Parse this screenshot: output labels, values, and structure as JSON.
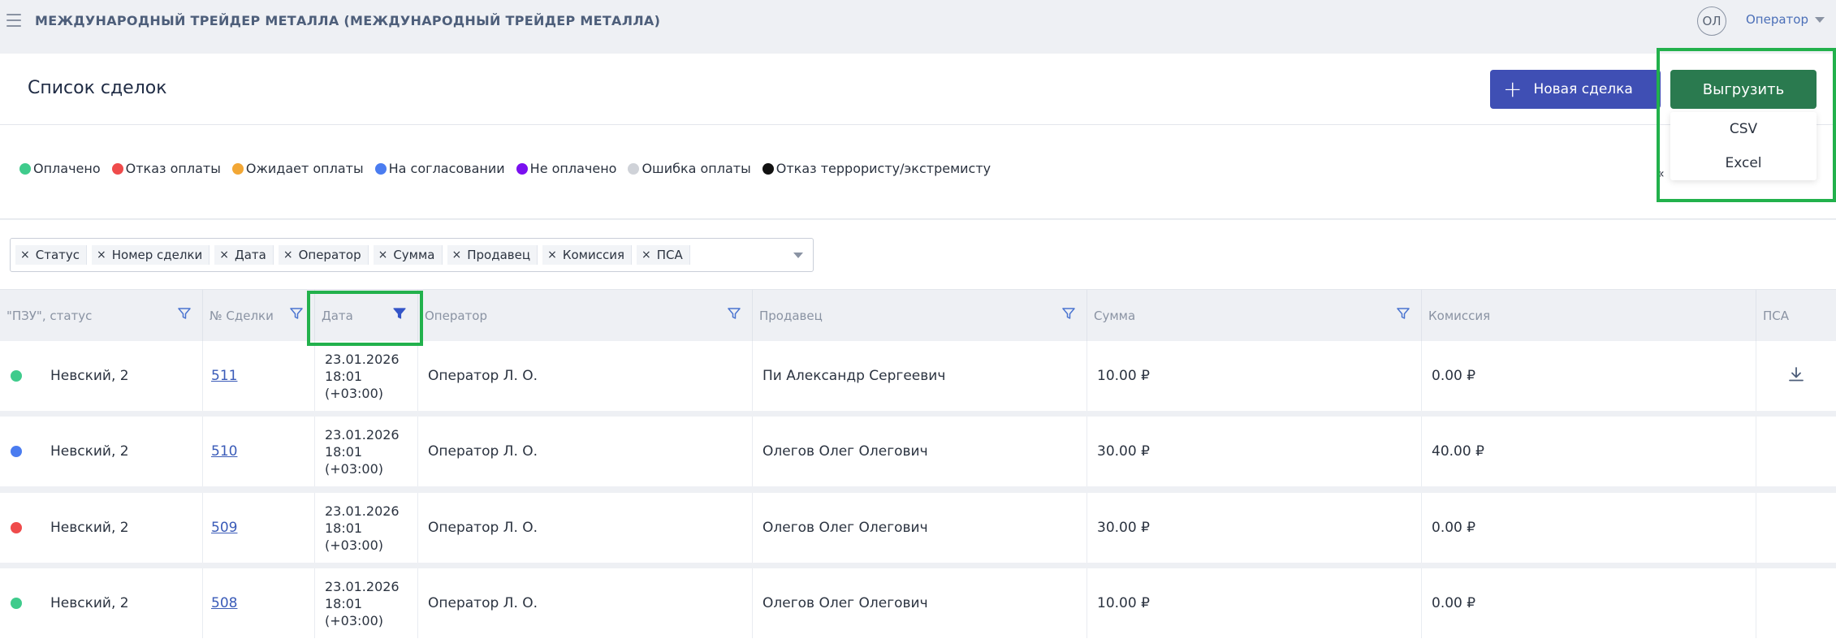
{
  "topbar": {
    "org_title": "МЕЖДУНАРОДНЫЙ ТРЕЙДЕР МЕТАЛЛА (МЕЖДУНАРОДНЫЙ ТРЕЙДЕР МЕТАЛЛА)",
    "avatar_initials": "ОЛ",
    "user_role": "Оператор"
  },
  "header": {
    "title": "Список сделок",
    "new_deal_label": "Новая сделка",
    "export_label": "Выгрузить",
    "export_options": [
      "CSV",
      "Excel"
    ]
  },
  "legend": {
    "items": [
      {
        "label": "Оплачено",
        "color": "#3fcb8c"
      },
      {
        "label": "Отказ оплаты",
        "color": "#ef4b4b"
      },
      {
        "label": "Ожидает оплаты",
        "color": "#f2a735"
      },
      {
        "label": "На согласовании",
        "color": "#4a7cf0"
      },
      {
        "label": "Не оплачено",
        "color": "#7a10f0"
      },
      {
        "label": "Ошибка оплаты",
        "color": "#cfd2d8"
      },
      {
        "label": "Отказ террористу/экстремисту",
        "color": "#111111"
      }
    ],
    "extra": "«"
  },
  "filters": {
    "tags": [
      "Статус",
      "Номер сделки",
      "Дата",
      "Оператор",
      "Сумма",
      "Продавец",
      "Комиссия",
      "ПСА"
    ]
  },
  "table": {
    "columns": [
      "\"ПЗУ\", статус",
      "№ Сделки",
      "Дата",
      "Оператор",
      "Продавец",
      "Сумма",
      "Комиссия",
      "ПСА"
    ],
    "rows": [
      {
        "status_color": "#3fcb8c",
        "pzu": "Невский, 2",
        "number": "511",
        "date": "23.01.2026",
        "time": "18:01",
        "tz": "(+03:00)",
        "operator": "Оператор Л. О.",
        "seller": "Пи Александр Сергеевич",
        "sum": "10.00 ₽",
        "commission": "0.00 ₽",
        "psa_download": true
      },
      {
        "status_color": "#4a7cf0",
        "pzu": "Невский, 2",
        "number": "510",
        "date": "23.01.2026",
        "time": "18:01",
        "tz": "(+03:00)",
        "operator": "Оператор Л. О.",
        "seller": "Олегов Олег Олегович",
        "sum": "30.00 ₽",
        "commission": "40.00 ₽",
        "psa_download": false
      },
      {
        "status_color": "#ef4b4b",
        "pzu": "Невский, 2",
        "number": "509",
        "date": "23.01.2026",
        "time": "18:01",
        "tz": "(+03:00)",
        "operator": "Оператор Л. О.",
        "seller": "Олегов Олег Олегович",
        "sum": "30.00 ₽",
        "commission": "0.00 ₽",
        "psa_download": false
      },
      {
        "status_color": "#3fcb8c",
        "pzu": "Невский, 2",
        "number": "508",
        "date": "23.01.2026",
        "time": "18:01",
        "tz": "(+03:00)",
        "operator": "Оператор Л. О.",
        "seller": "Олегов Олег Олегович",
        "sum": "10.00 ₽",
        "commission": "0.00 ₽",
        "psa_download": false
      }
    ]
  },
  "colors": {
    "primary": "#3f4fb4",
    "export": "#2a7a4f",
    "highlight": "#22b14c",
    "link": "#3a5bb8"
  }
}
